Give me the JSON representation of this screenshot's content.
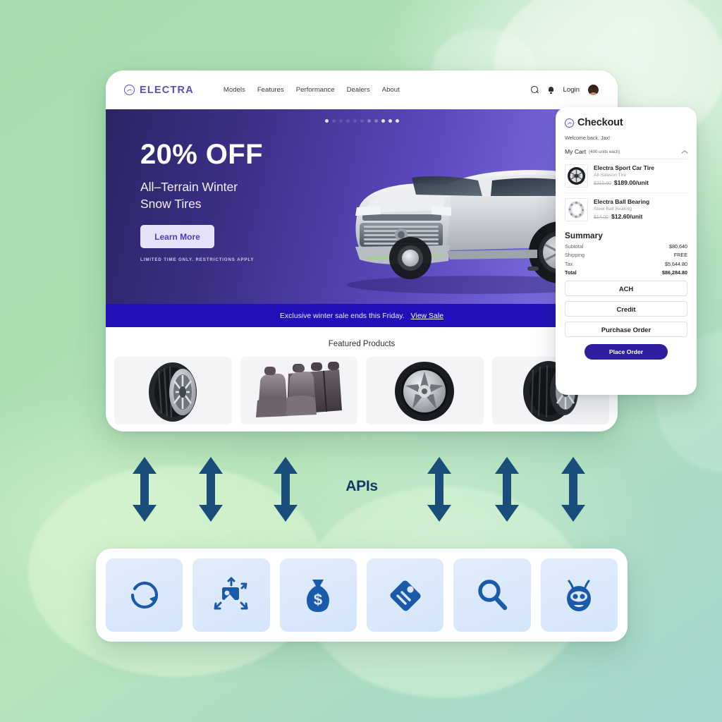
{
  "background": {
    "gradient_from": "#a6ddb0",
    "gradient_to": "#a3d8d0"
  },
  "site": {
    "nav": {
      "brand": "ELECTRA",
      "brand_icon": "electra-circle-wave-logo",
      "links": [
        "Models",
        "Features",
        "Performance",
        "Dealers",
        "About"
      ],
      "search_icon": "search-icon",
      "bell_icon": "bell-icon",
      "login_label": "Login",
      "avatar": "user-avatar"
    },
    "hero": {
      "headline": "20% OFF",
      "subline": "All-Terrain Winter\nSnow Tires",
      "cta_label": "Learn More",
      "fine_print": "LIMITED TIME ONLY. RESTRICTIONS APPLY",
      "carousel_dots": 11,
      "carousel_active_index": 8,
      "vehicle_image": "silver-suv-illustration",
      "bg_from": "#2b2566",
      "bg_to": "#8477e6"
    },
    "promo": {
      "text": "Exclusive winter sale ends this Friday.",
      "link_label": "View Sale",
      "bg": "#2110b8"
    },
    "featured": {
      "title": "Featured Products",
      "products": [
        {
          "image": "winter-tire"
        },
        {
          "image": "car-seats"
        },
        {
          "image": "alloy-wheel"
        },
        {
          "image": "performance-tire"
        }
      ]
    }
  },
  "checkout": {
    "logo_icon": "electra-circle-wave-logo",
    "title": "Checkout",
    "welcome": "Welcome back, Jax!",
    "cart_label": "My Cart",
    "cart_units": "(400 units each)",
    "collapse_icon": "chevron-up-icon",
    "items": [
      {
        "thumb": "tire-wheel-thumb",
        "name": "Electra Sport Car Tire",
        "desc": "All-Season Tire",
        "old_price": "$210.00",
        "new_price": "$189.00/unit"
      },
      {
        "thumb": "ball-bearing-thumb",
        "name": "Electra Ball Bearing",
        "desc": "Steel Ball Bearing",
        "old_price": "$14.00",
        "new_price": "$12.60/unit"
      }
    ],
    "summary_title": "Summary",
    "summary": [
      {
        "label": "Subtotal",
        "value": "$80,640"
      },
      {
        "label": "Shipping",
        "value": "FREE"
      },
      {
        "label": "Tax",
        "value": "$5,644.80"
      },
      {
        "label": "Total",
        "value": "$86,284.80"
      }
    ],
    "payment_options": [
      "ACH",
      "Credit",
      "Purchase Order"
    ],
    "place_order_label": "Place Order",
    "accent": "#2d1f9e"
  },
  "apis": {
    "label": "APIs",
    "label_color": "#123a63",
    "arrow_color": "#1a4d7a",
    "arrow_count": 6
  },
  "api_bar": {
    "tiles": [
      {
        "icon": "sync-refresh-icon"
      },
      {
        "icon": "image-resize-icon"
      },
      {
        "icon": "money-bag-icon"
      },
      {
        "icon": "price-tag-icon"
      },
      {
        "icon": "search-magnifier-icon"
      },
      {
        "icon": "bot-face-icon"
      }
    ],
    "icon_color": "#1b5aa8"
  }
}
